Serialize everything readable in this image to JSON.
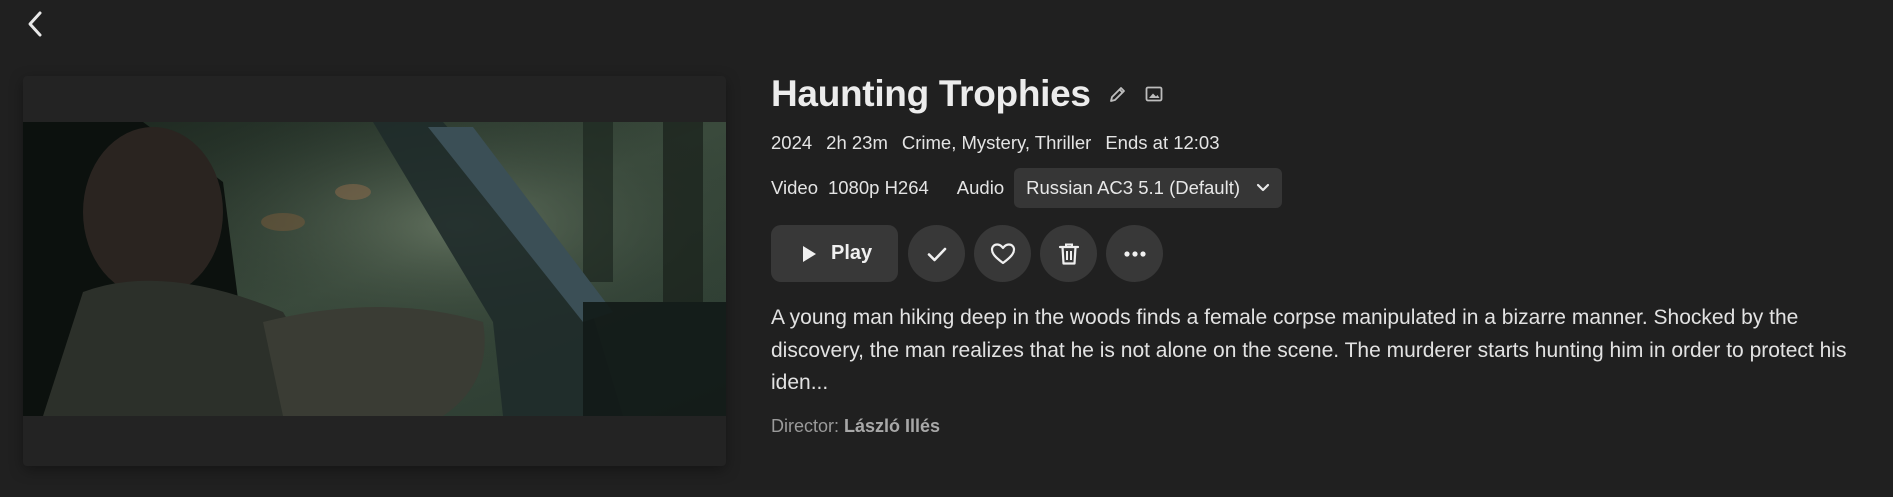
{
  "nav": {
    "back_icon": "chevron-left-icon"
  },
  "movie": {
    "title": "Haunting Trophies",
    "year": "2024",
    "runtime": "2h 23m",
    "genres": "Crime, Mystery, Thriller",
    "ends_at": "Ends at 12:03",
    "video_label": "Video",
    "video_value": "1080p H264",
    "audio_label": "Audio",
    "audio_selected": "Russian AC3 5.1 (Default)",
    "overview": "A young man hiking deep in the woods finds a female corpse manipulated in a bizarre manner. Shocked by the discovery, the man realizes that he is not alone on the scene. The murderer starts hunting him in order to protect his iden...",
    "director_label": "Director:",
    "director_name": "László Illés"
  },
  "actions": {
    "play_label": "Play",
    "icons": [
      "play-icon",
      "check-icon",
      "heart-icon",
      "trash-icon",
      "more-icon"
    ]
  },
  "colors": {
    "background": "#202020",
    "button_bg": "#383838",
    "select_bg": "#363636",
    "text_primary": "#ececec",
    "text_muted": "#9a9a9a"
  }
}
